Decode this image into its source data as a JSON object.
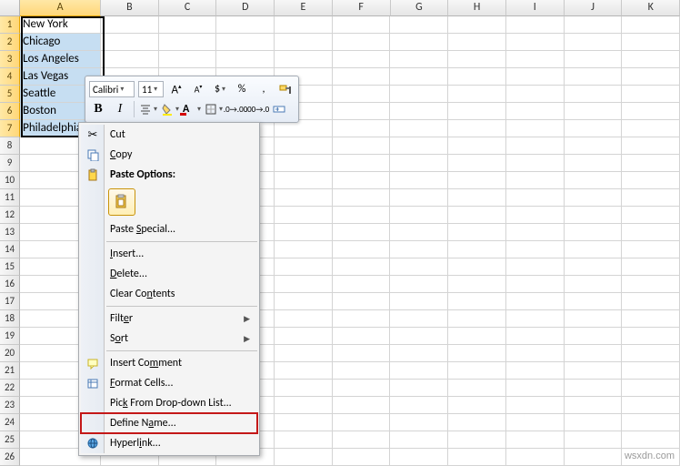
{
  "columns": [
    "A",
    "B",
    "C",
    "D",
    "E",
    "F",
    "G",
    "H",
    "I",
    "J",
    "K"
  ],
  "row_count": 26,
  "selected_col": "A",
  "selected_rows": [
    1,
    2,
    3,
    4,
    5,
    6,
    7
  ],
  "data_a": [
    "New York",
    "Chicago",
    "Los Angeles",
    "Las Vegas",
    "Seattle",
    "Boston",
    "Philadelphia"
  ],
  "mini_toolbar": {
    "font": "Calibri",
    "size": "11",
    "grow_icon": "A",
    "shrink_icon": "A",
    "currency": "$",
    "percent": "%",
    "comma": ",",
    "bold": "B",
    "italic": "I"
  },
  "context_menu": {
    "cut": "Cut",
    "copy": "Copy",
    "paste_options": "Paste Options:",
    "paste_special": "Paste Special...",
    "insert": "Insert...",
    "delete": "Delete...",
    "clear": "Clear Contents",
    "filter": "Filter",
    "sort": "Sort",
    "insert_comment": "Insert Comment",
    "format_cells": "Format Cells...",
    "pick_list": "Pick From Drop-down List...",
    "define_name": "Define Name...",
    "hyperlink": "Hyperlink..."
  },
  "watermark": "wsxdn.com"
}
